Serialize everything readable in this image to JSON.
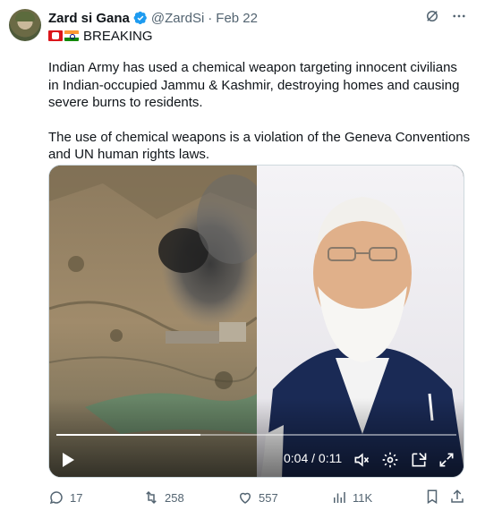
{
  "author": {
    "name": "Zard si Gana",
    "handle": "@ZardSi",
    "separator": "·",
    "date": "Feb 22"
  },
  "flags": [
    "oman-flag",
    "india-flag"
  ],
  "breaking_label": "BREAKING",
  "body": {
    "paragraph_1": "Indian Army has used a chemical weapon targeting innocent civilians in Indian-occupied Jammu & Kashmir, destroying homes and causing severe burns to residents.",
    "paragraph_2": "The use of chemical weapons is a violation of the Geneva Conventions and UN human rights laws."
  },
  "video": {
    "time_display": "0:04 / 0:11",
    "progress_fraction": 0.36,
    "icons": [
      "play-icon",
      "mute-icon",
      "settings-icon",
      "pip-icon",
      "fullscreen-icon"
    ]
  },
  "engagement": {
    "replies": "17",
    "reposts": "258",
    "likes": "557",
    "views": "11K"
  },
  "colors": {
    "text": "#0f1419",
    "secondary": "#536471",
    "verified": "#1d9bf0"
  }
}
